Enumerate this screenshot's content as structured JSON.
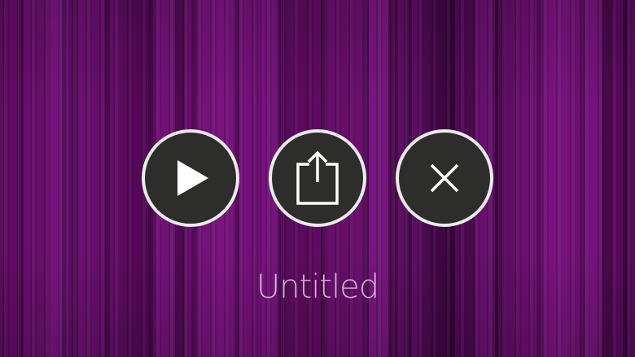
{
  "screen": {
    "title": "Untitled",
    "background_color": "#5a0a5c"
  },
  "controls": {
    "play": {
      "icon": "play-icon"
    },
    "share": {
      "icon": "share-icon"
    },
    "close": {
      "icon": "close-icon"
    }
  },
  "colors": {
    "button_fill": "#2d2e2b",
    "button_border": "#ececec",
    "icon": "#ffffff",
    "title_text": "#ecc8f0"
  }
}
